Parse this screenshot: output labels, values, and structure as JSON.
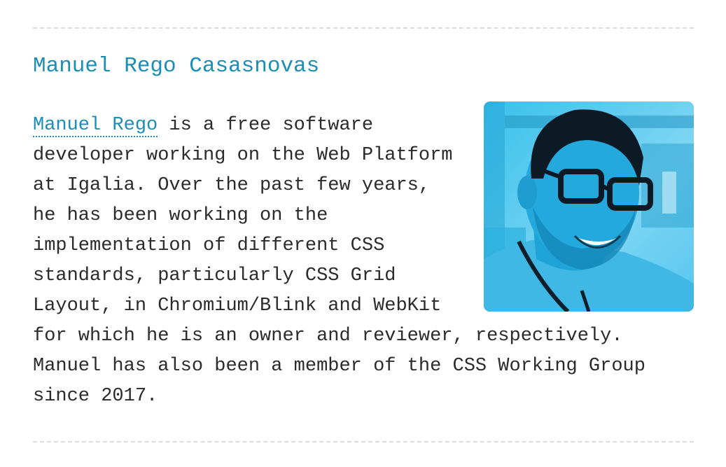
{
  "profile": {
    "name": "Manuel Rego Casasnovas",
    "photo_alt": "Portrait of Manuel Rego Casasnovas",
    "bio_link": "Manuel Rego",
    "bio_text": " is a free software developer working on the Web Platform at Igalia. Over the past few years, he has been working on the implementation of different CSS standards, particularly CSS Grid Layout, in Chromium/Blink and WebKit for which he is an owner and reviewer, respectively. Manuel has also been a member of the CSS Working Group since 2017."
  },
  "colors": {
    "accent": "#1b8eb5",
    "text": "#2b2b2b",
    "rule": "#dcdcdc",
    "photo_tint": "#2fb3e0"
  }
}
